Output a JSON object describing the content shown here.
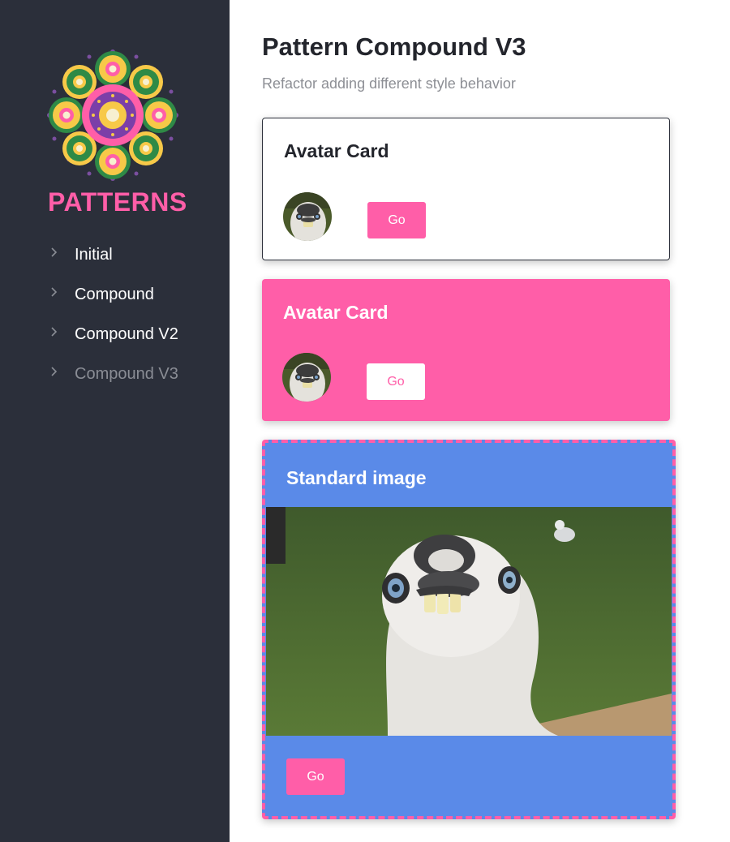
{
  "sidebar": {
    "brand": "PATTERNS",
    "items": [
      {
        "label": "Initial",
        "active": false
      },
      {
        "label": "Compound",
        "active": false
      },
      {
        "label": "Compound V2",
        "active": false
      },
      {
        "label": "Compound V3",
        "active": true
      }
    ]
  },
  "main": {
    "title": "Pattern Compound V3",
    "subtitle": "Refactor adding different style behavior",
    "cards": [
      {
        "title": "Avatar Card",
        "button": "Go",
        "variant": "outline"
      },
      {
        "title": "Avatar Card",
        "button": "Go",
        "variant": "pink"
      },
      {
        "title": "Standard image",
        "button": "Go",
        "variant": "blue-dashed"
      }
    ]
  },
  "colors": {
    "sidebar_bg": "#2b2f3a",
    "accent_pink": "#ff5ea8",
    "card_blue": "#5a8ae8",
    "active_nav": "#8a8d95"
  },
  "icons": {
    "logo": "mandala-logo",
    "nav": "chevron-right-icon"
  }
}
